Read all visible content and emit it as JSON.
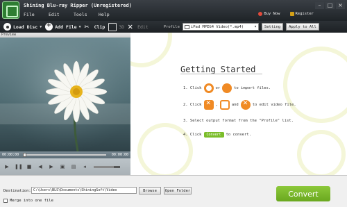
{
  "window": {
    "title": "Shining Blu-ray Ripper (Unregistered)",
    "controls": [
      "–",
      "□",
      "×"
    ]
  },
  "menu": [
    "File",
    "Edit",
    "Tools",
    "Help"
  ],
  "top_links": {
    "buy_now": "Buy Now",
    "register": "Register"
  },
  "toolbar": {
    "load_disc": "Load Disc",
    "add_file": "Add File",
    "clip": "Clip",
    "three_d": "3D",
    "edit": "Edit",
    "profile_label": "Profile",
    "profile_value": "iPad MPEG4 Video(*.mp4)",
    "setting": "Setting",
    "apply_to_all": "Apply to All"
  },
  "preview": {
    "header": "Preview",
    "time_current": "00:00:00",
    "time_total": "00:00:00",
    "volume_level": 0.75
  },
  "getting_started": {
    "title": "Getting Started",
    "step1_a": "1. Click",
    "step1_or": "or",
    "step1_b": "to import files.",
    "step2_a": "2. Click",
    "step2_sep": ",",
    "step2_and": "and",
    "step2_b": "to edit video file.",
    "step3": "3. Select output format from the \"Profile\" list.",
    "step4_a": "4. Click",
    "step4_chip": "Convert",
    "step4_b": "to convert."
  },
  "bottom": {
    "destination_label": "Destination:",
    "destination_value": "C:\\Users\\BLS\\Documents\\ShiningSoft\\Video",
    "browse": "Browse",
    "open_folder": "Open Folder",
    "merge_label": "Merge into one file",
    "convert": "Convert"
  },
  "colors": {
    "accent_green": "#7bbd2a",
    "accent_orange": "#f08a24",
    "toolbar_dark": "#1f2428"
  }
}
